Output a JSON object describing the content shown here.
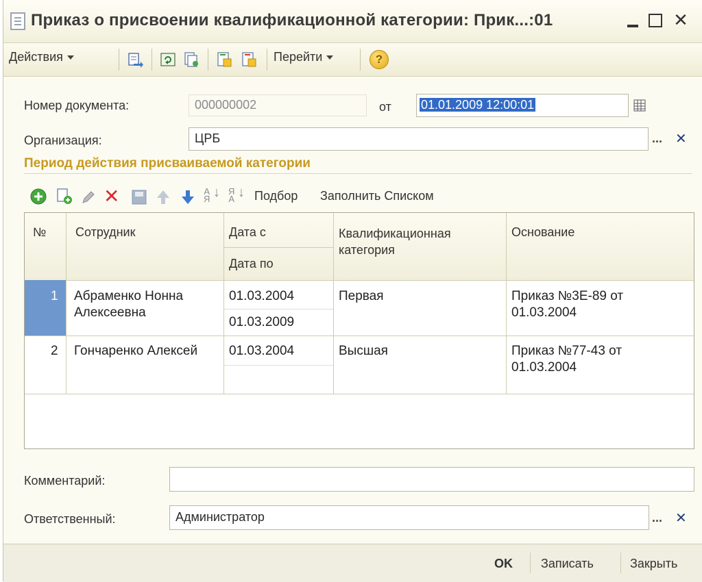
{
  "window": {
    "title": "Приказ о присвоении квалификационной категории: Прик...:01",
    "close_glyph": "✕"
  },
  "toolbar": {
    "actions_label": "Действия",
    "goto_label": "Перейти",
    "help_glyph": "?"
  },
  "form": {
    "doc_number_label": "Номер документа:",
    "doc_number_value": "000000002",
    "date_from_label": "от",
    "date_value": "01.01.2009 12:00:01",
    "org_label": "Организация:",
    "org_value": "ЦРБ",
    "group_title": "Период действия присваиваемой категории",
    "comment_label": "Комментарий:",
    "comment_value": "",
    "responsible_label": "Ответственный:",
    "responsible_value": "Администратор",
    "dots": "...",
    "clear_glyph": "✕"
  },
  "table_toolbar": {
    "pick_label": "Подбор",
    "fill_list_label": "Заполнить Списком"
  },
  "table": {
    "headers": {
      "num": "№",
      "employee": "Сотрудник",
      "date_from": "Дата с",
      "date_to": "Дата по",
      "category": "Квалификационная категория",
      "basis": "Основание"
    },
    "rows": [
      {
        "num": "1",
        "employee": "Абраменко Нонна Алексеевна",
        "date_from": "01.03.2004",
        "date_to": "01.03.2009",
        "category": "Первая",
        "basis": "Приказ №3Е-89 от 01.03.2004"
      },
      {
        "num": "2",
        "employee": "Гончаренко Алексей",
        "date_from": "01.03.2004",
        "date_to": "",
        "category": "Высшая",
        "basis": "Приказ №77-43 от 01.03.2004"
      }
    ]
  },
  "footer": {
    "ok_label": "OK",
    "save_label": "Записать",
    "close_label": "Закрыть"
  },
  "colors": {
    "group_title": "#c79a1f",
    "selection": "#316ac5",
    "row_marker": "#6e98cd"
  }
}
